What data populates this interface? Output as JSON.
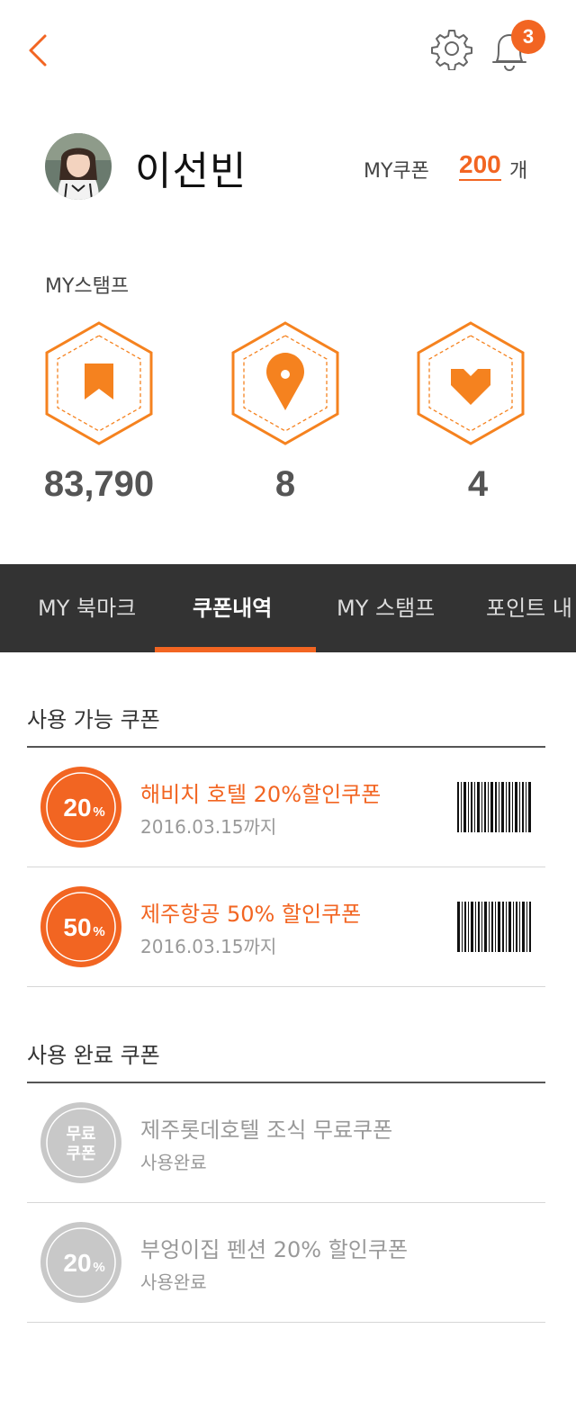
{
  "header": {
    "notification_count": "3"
  },
  "profile": {
    "name": "이선빈",
    "coupon_label": "MY쿠폰",
    "coupon_count": "200",
    "coupon_unit": "개"
  },
  "stamps": {
    "title": "MY스탬프",
    "items": [
      {
        "icon": "bookmark-icon",
        "value": "83,790"
      },
      {
        "icon": "location-pin-icon",
        "value": "8"
      },
      {
        "icon": "heart-icon",
        "value": "4"
      }
    ]
  },
  "tabs": [
    {
      "label": "MY 북마크",
      "active": false
    },
    {
      "label": "쿠폰내역",
      "active": true
    },
    {
      "label": "MY 스탬프",
      "active": false
    },
    {
      "label": "포인트 내",
      "active": false
    }
  ],
  "available": {
    "title": "사용 가능 쿠폰",
    "items": [
      {
        "badge_num": "20",
        "badge_unit": "%",
        "name": "해비치 호텔 20%할인쿠폰",
        "sub": "2016.03.15까지"
      },
      {
        "badge_num": "50",
        "badge_unit": "%",
        "name": "제주항공 50% 할인쿠폰",
        "sub": "2016.03.15까지"
      }
    ]
  },
  "used": {
    "title": "사용 완료 쿠폰",
    "items": [
      {
        "badge_line1": "무료",
        "badge_line2": "쿠폰",
        "name": "제주롯데호텔 조식 무료쿠폰",
        "sub": "사용완료"
      },
      {
        "badge_num": "20",
        "badge_unit": "%",
        "name": "부엉이집 펜션 20% 할인쿠폰",
        "sub": "사용완료"
      }
    ]
  },
  "colors": {
    "accent": "#f26522",
    "stamp_orange": "#f5821f",
    "tabbar_bg": "#333333",
    "used_gray": "#c8c8c8"
  }
}
